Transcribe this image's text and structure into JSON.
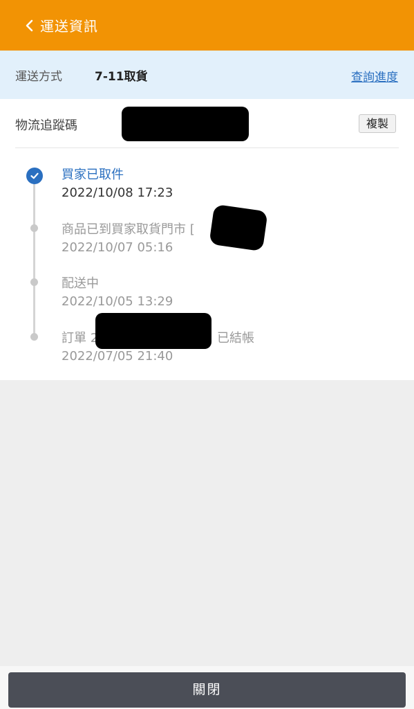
{
  "header": {
    "title": "運送資訊",
    "back_icon": "chevron-left-icon"
  },
  "shipping": {
    "label": "運送方式",
    "method": "7-11取貨",
    "track_link": "查詢進度"
  },
  "tracking": {
    "label": "物流追蹤碼",
    "copy_label": "複製"
  },
  "timeline": [
    {
      "status": "買家已取件",
      "time": "2022/10/08 17:23",
      "active": true
    },
    {
      "status": "商品已到買家取貨門市 [",
      "time": "2022/10/07 05:16",
      "active": false
    },
    {
      "status": "配送中",
      "time": "2022/10/05 13:29",
      "active": false
    },
    {
      "status_prefix": "訂單 2",
      "status_suffix": "已結帳",
      "time": "2022/07/05 21:40",
      "active": false
    }
  ],
  "footer": {
    "close_label": "關閉"
  },
  "colors": {
    "header": "#f29304",
    "accent": "#2a6fc0",
    "ship_bg": "#e2f0fb",
    "button": "#4b4e57"
  }
}
